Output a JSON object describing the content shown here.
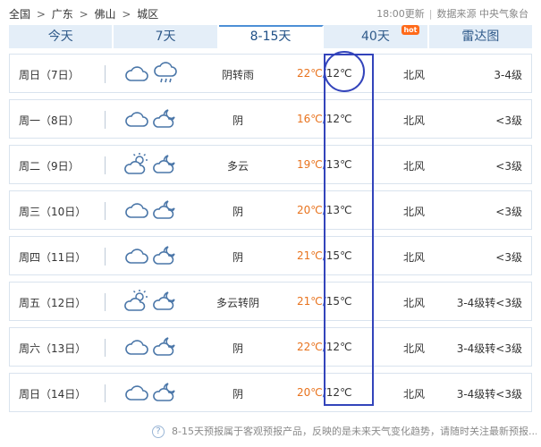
{
  "breadcrumb": [
    "全国",
    "广东",
    "佛山",
    "城区"
  ],
  "breadcrumb_sep": ">",
  "update": {
    "time": "18:00更新",
    "divider": "|",
    "source": "数据来源 中央气象台"
  },
  "tabs": [
    {
      "label": "今天",
      "active": false
    },
    {
      "label": "7天",
      "active": false
    },
    {
      "label": "8-15天",
      "active": true
    },
    {
      "label": "40天",
      "active": false
    },
    {
      "label": "雷达图",
      "active": false
    }
  ],
  "hot_badge": "hot",
  "rows": [
    {
      "day": "周日（7日）",
      "icon1": "cloud-icon",
      "icon2": "rain-icon",
      "desc": "阴转雨",
      "high": "22℃",
      "low": "12℃",
      "wind": "北风",
      "level": "3-4级"
    },
    {
      "day": "周一（8日）",
      "icon1": "cloud-icon",
      "icon2": "moon-cloud-icon",
      "desc": "阴",
      "high": "16℃",
      "low": "12℃",
      "wind": "北风",
      "level": "<3级"
    },
    {
      "day": "周二（9日）",
      "icon1": "sun-cloud-icon",
      "icon2": "moon-cloud-icon",
      "desc": "多云",
      "high": "19℃",
      "low": "13℃",
      "wind": "北风",
      "level": "<3级"
    },
    {
      "day": "周三（10日）",
      "icon1": "cloud-icon",
      "icon2": "moon-cloud-icon",
      "desc": "阴",
      "high": "20℃",
      "low": "13℃",
      "wind": "北风",
      "level": "<3级"
    },
    {
      "day": "周四（11日）",
      "icon1": "cloud-icon",
      "icon2": "moon-cloud-icon",
      "desc": "阴",
      "high": "21℃",
      "low": "15℃",
      "wind": "北风",
      "level": "<3级"
    },
    {
      "day": "周五（12日）",
      "icon1": "sun-cloud-icon",
      "icon2": "moon-cloud-icon",
      "desc": "多云转阴",
      "high": "21℃",
      "low": "15℃",
      "wind": "北风",
      "level": "3-4级转<3级"
    },
    {
      "day": "周六（13日）",
      "icon1": "cloud-icon",
      "icon2": "moon-cloud-icon",
      "desc": "阴",
      "high": "22℃",
      "low": "12℃",
      "wind": "北风",
      "level": "3-4级转<3级"
    },
    {
      "day": "周日（14日）",
      "icon1": "cloud-icon",
      "icon2": "moon-cloud-icon",
      "desc": "阴",
      "high": "20℃",
      "low": "12℃",
      "wind": "北风",
      "level": "3-4级转<3级"
    }
  ],
  "temp_sep": "/",
  "footnote": "8-15天预报属于客观预报产品，反映的是未来天气变化趋势，请随时关注最新预报......",
  "colors": {
    "tab_bg": "#e4eef8",
    "tab_text": "#2f5a8a",
    "high_temp": "#e8731e",
    "annotation": "#3344bb",
    "row_border": "#d9e3ee"
  }
}
